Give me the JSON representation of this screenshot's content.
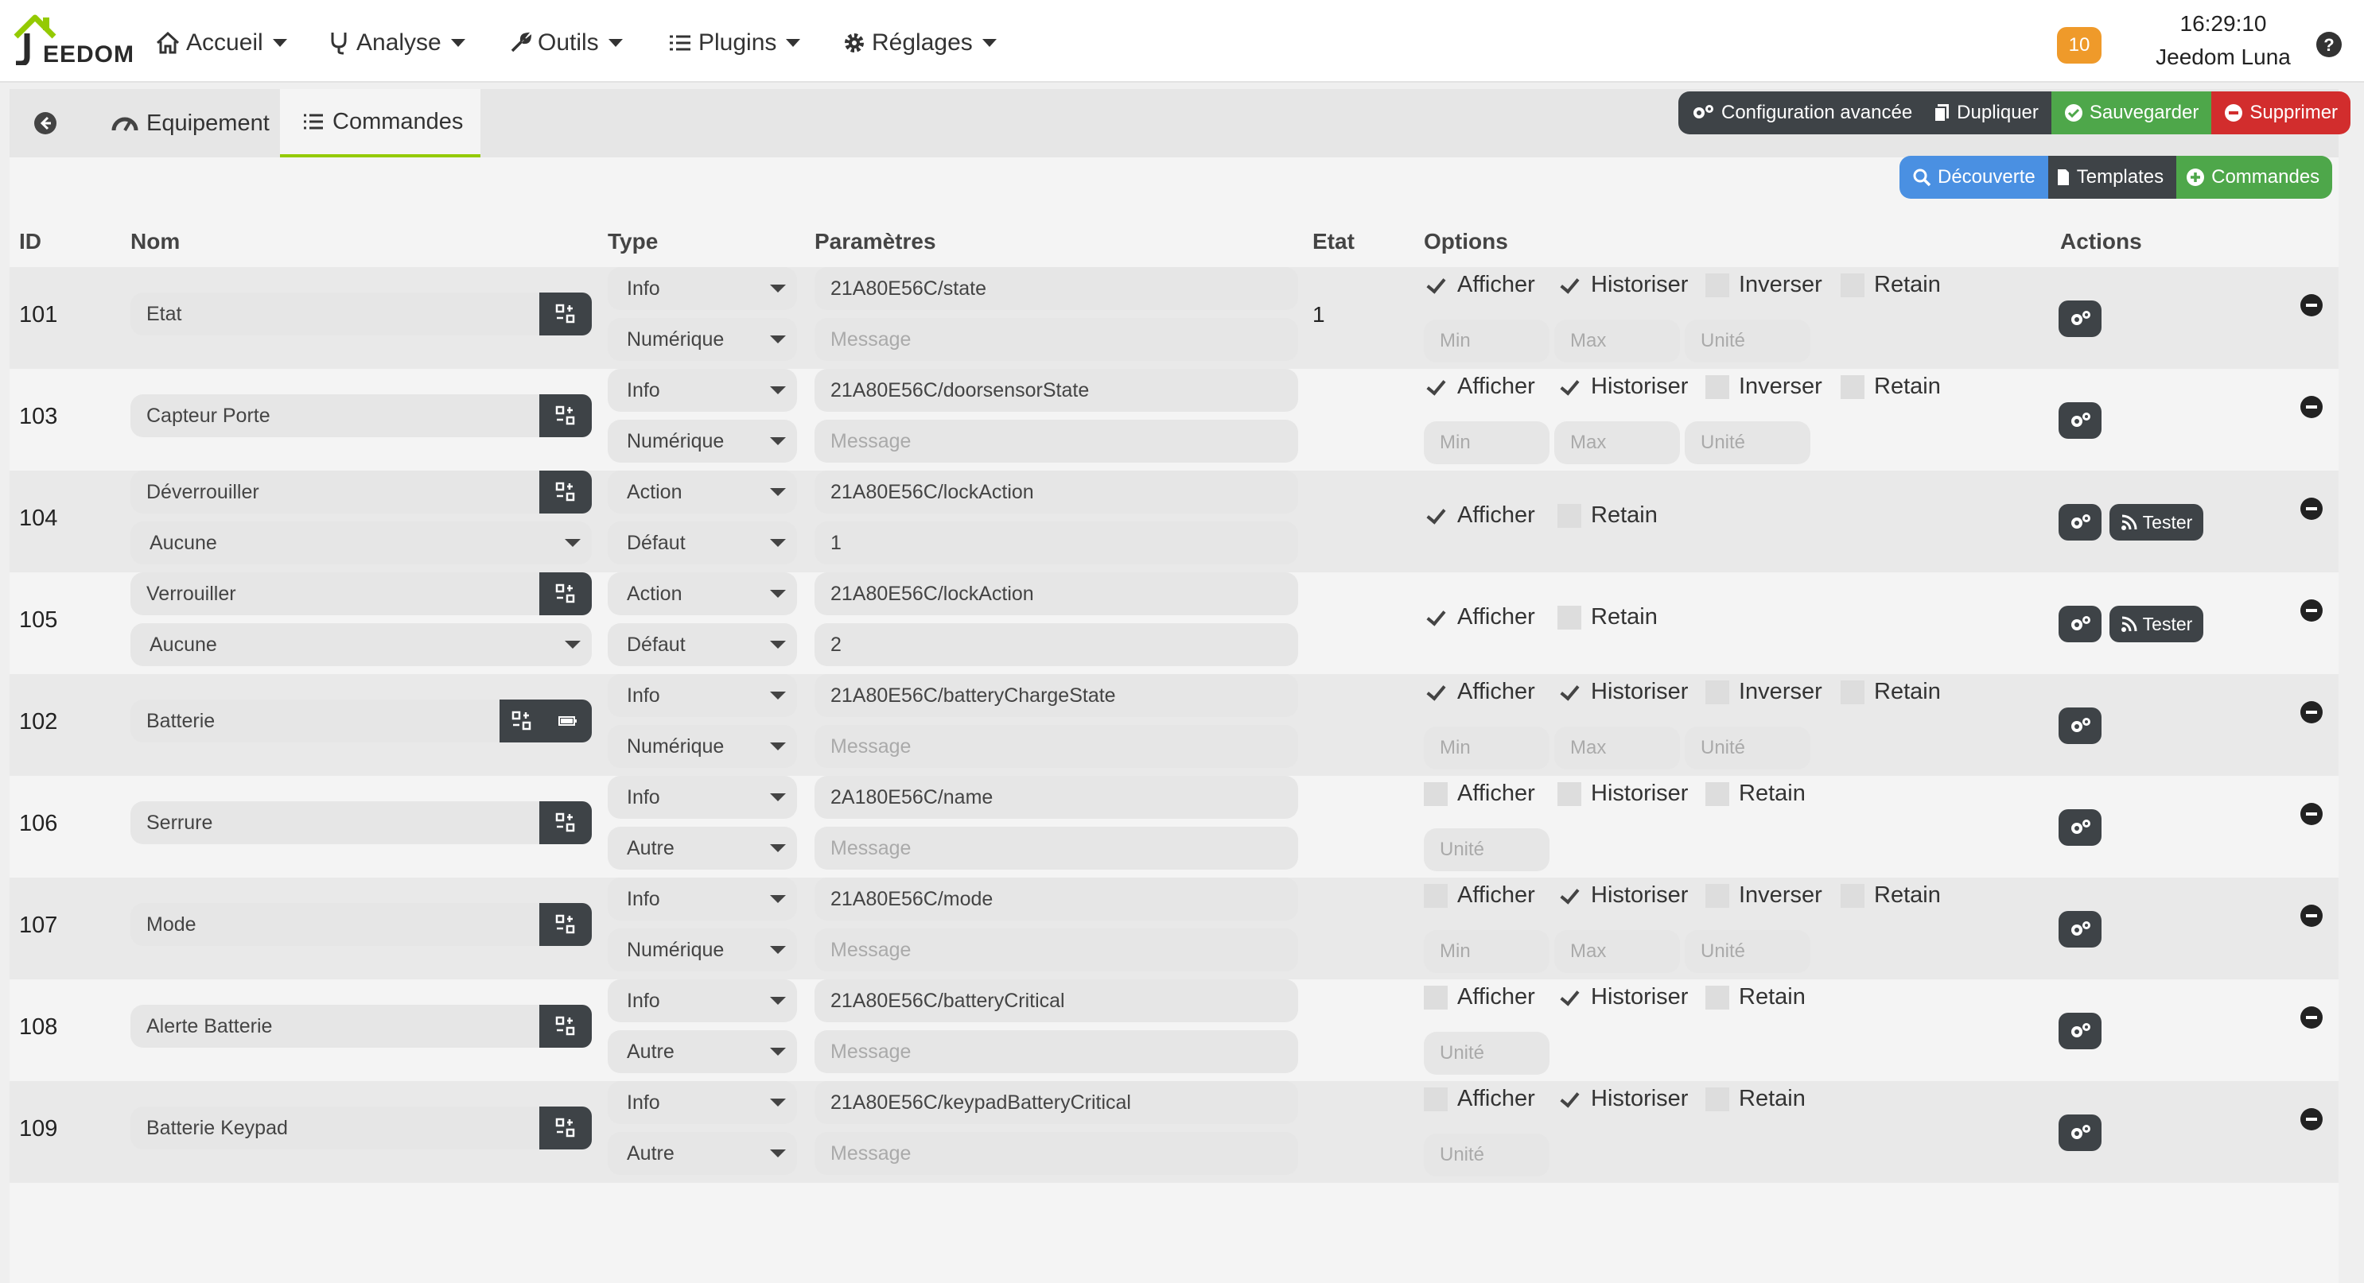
{
  "header": {
    "logo_text": "EEDOM",
    "menu": [
      {
        "label": "Accueil",
        "icon": "home-icon"
      },
      {
        "label": "Analyse",
        "icon": "stethoscope-icon"
      },
      {
        "label": "Outils",
        "icon": "wrench-icon"
      },
      {
        "label": "Plugins",
        "icon": "list-icon"
      },
      {
        "label": "Réglages",
        "icon": "cog-icon"
      }
    ],
    "notifications": "10",
    "time": "16:29:10",
    "user": "Jeedom Luna"
  },
  "tabs": {
    "back": "back-arrow-icon",
    "equipement": "Equipement",
    "commandes": "Commandes"
  },
  "toolbar": {
    "config": "Configuration avancée",
    "dupliquer": "Dupliquer",
    "sauvegarder": "Sauvegarder",
    "supprimer": "Supprimer",
    "decouverte": "Découverte",
    "templates": "Templates",
    "commandes": "Commandes"
  },
  "colors": {
    "accent": "#94ca02",
    "dark": "#3e4347",
    "green": "#4ea74a",
    "red": "#d22d2d",
    "blue": "#4a90e2",
    "badge": "#ef9a2a"
  },
  "columns": {
    "id": "ID",
    "nom": "Nom",
    "type": "Type",
    "parametres": "Paramètres",
    "etat": "Etat",
    "options": "Options",
    "actions": "Actions"
  },
  "labels": {
    "afficher": "Afficher",
    "historiser": "Historiser",
    "inverser": "Inverser",
    "retain": "Retain",
    "min": "Min",
    "max": "Max",
    "unite": "Unité",
    "message": "Message",
    "tester": "Tester"
  },
  "rows": [
    {
      "id": "101",
      "name": "Etat",
      "type": "Info",
      "subtype": "Numérique",
      "topic": "21A80E56C/state",
      "value": "Message",
      "etat": "1",
      "afficher": true,
      "historiser": true,
      "inverser": false,
      "retain": false
    },
    {
      "id": "103",
      "name": "Capteur Porte",
      "type": "Info",
      "subtype": "Numérique",
      "topic": "21A80E56C/doorsensorState",
      "value": "Message",
      "etat": "",
      "afficher": true,
      "historiser": true,
      "inverser": false,
      "retain": false
    },
    {
      "id": "104",
      "name": "Déverrouiller",
      "name2": "Aucune",
      "type": "Action",
      "subtype": "Défaut",
      "topic": "21A80E56C/lockAction",
      "value": "1",
      "etat": "",
      "afficher": true,
      "retain": false
    },
    {
      "id": "105",
      "name": "Verrouiller",
      "name2": "Aucune",
      "type": "Action",
      "subtype": "Défaut",
      "topic": "21A80E56C/lockAction",
      "value": "2",
      "etat": "",
      "afficher": true,
      "retain": false
    },
    {
      "id": "102",
      "name": "Batterie",
      "type": "Info",
      "subtype": "Numérique",
      "topic": "21A80E56C/batteryChargeState",
      "value": "Message",
      "etat": "",
      "afficher": true,
      "historiser": true,
      "inverser": false,
      "retain": false
    },
    {
      "id": "106",
      "name": "Serrure",
      "type": "Info",
      "subtype": "Autre",
      "topic": "2A180E56C/name",
      "value": "Message",
      "etat": "",
      "afficher": false,
      "historiser": false,
      "retain": false
    },
    {
      "id": "107",
      "name": "Mode",
      "type": "Info",
      "subtype": "Numérique",
      "topic": "21A80E56C/mode",
      "value": "Message",
      "etat": "",
      "afficher": false,
      "historiser": true,
      "inverser": false,
      "retain": false
    },
    {
      "id": "108",
      "name": "Alerte Batterie",
      "type": "Info",
      "subtype": "Autre",
      "topic": "21A80E56C/batteryCritical",
      "value": "Message",
      "etat": "",
      "afficher": false,
      "historiser": true,
      "retain": false
    },
    {
      "id": "109",
      "name": "Batterie Keypad",
      "type": "Info",
      "subtype": "Autre",
      "topic": "21A80E56C/keypadBatteryCritical",
      "value": "Message",
      "etat": "",
      "afficher": false,
      "historiser": true,
      "retain": false
    }
  ]
}
